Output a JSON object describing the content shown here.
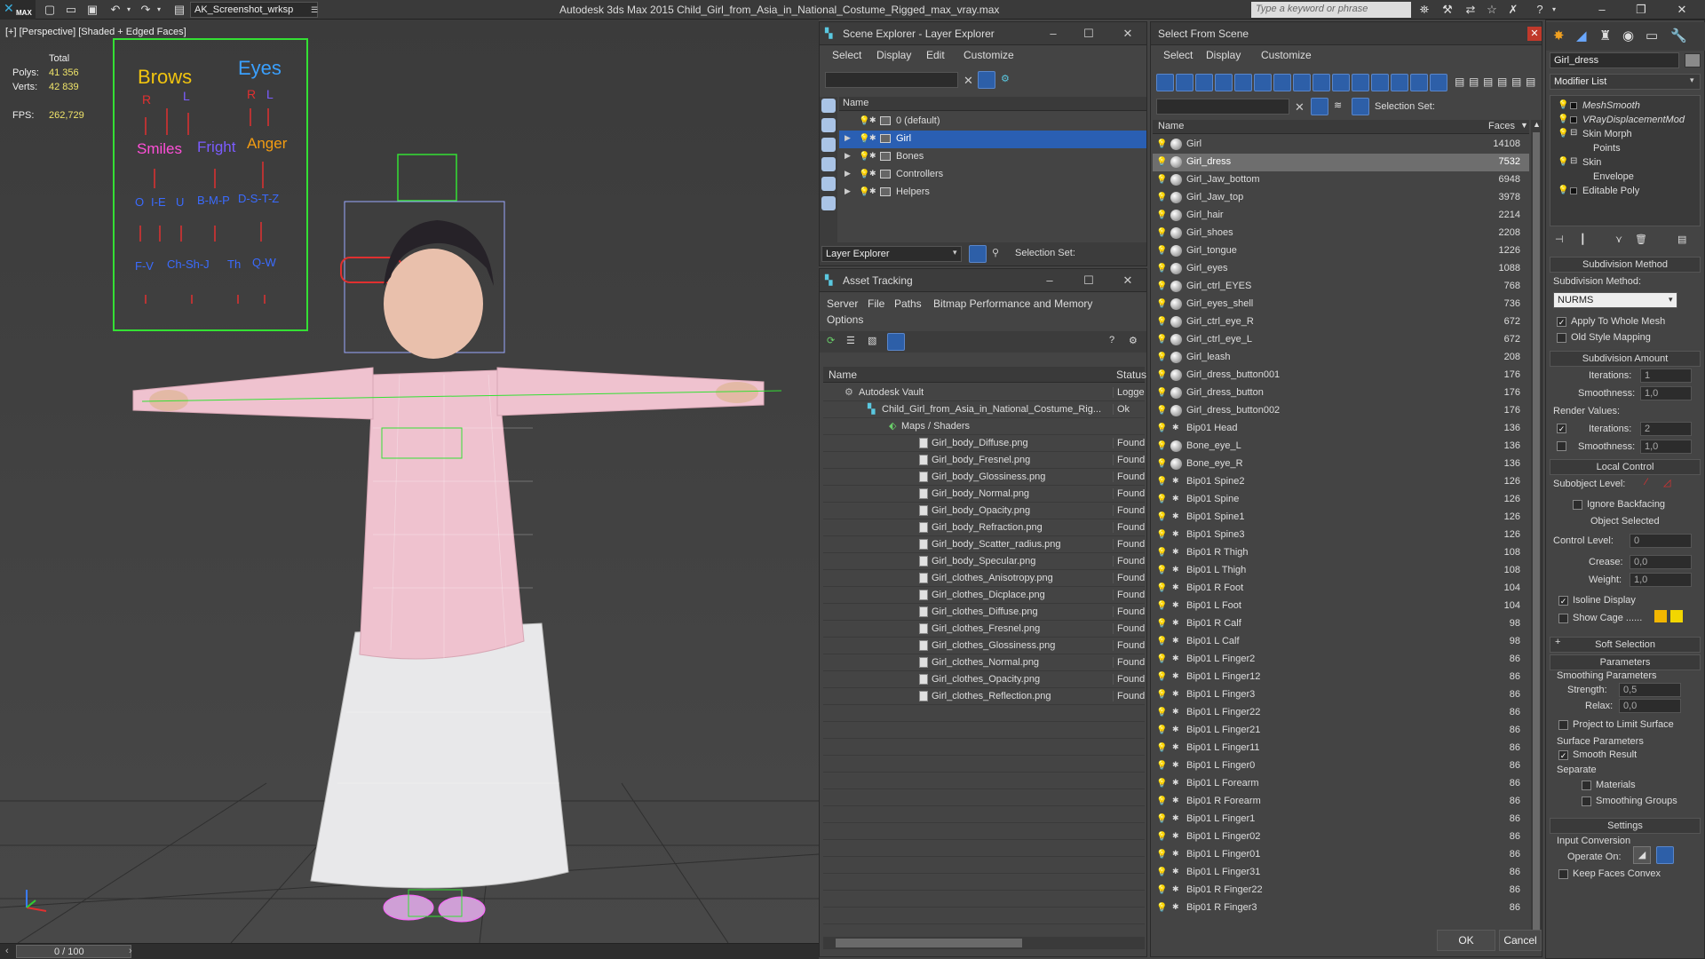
{
  "app": {
    "title": "Autodesk 3ds Max  2015     Child_Girl_from_Asia_in_National_Costume_Rigged_max_vray.max",
    "workspace": "AK_Screenshot_wrksp",
    "keyword_search_placeholder": "Type a keyword or phrase",
    "logo": "MAX"
  },
  "viewport": {
    "label": "[+] [Perspective] [Shaded + Edged Faces]",
    "stats": {
      "total_label": "Total",
      "polys_label": "Polys:",
      "polys_value": "41 356",
      "verts_label": "Verts:",
      "verts_value": "42 839",
      "fps_label": "FPS:",
      "fps_value": "262,729"
    },
    "control_board": {
      "brows": "Brows",
      "eyes": "Eyes",
      "r1": "R",
      "l1": "L",
      "r2": "R",
      "l2": "L",
      "smiles": "Smiles",
      "fright": "Fright",
      "anger": "Anger",
      "o": "O",
      "ie": "I-E",
      "u": "U",
      "bmp": "B-M-P",
      "dstz": "D-S-T-Z",
      "fv": "F-V",
      "chshj": "Ch-Sh-J",
      "th": "Th",
      "qw": "Q-W"
    },
    "timeline": "0 / 100"
  },
  "scene_explorer": {
    "title": "Scene Explorer - Layer Explorer",
    "menus": [
      "Select",
      "Display",
      "Edit",
      "Customize"
    ],
    "col_name": "Name",
    "layers": [
      {
        "name": "0 (default)",
        "selected": false,
        "expandable": false
      },
      {
        "name": "Girl",
        "selected": true,
        "expandable": true
      },
      {
        "name": "Bones",
        "selected": false,
        "expandable": true
      },
      {
        "name": "Controllers",
        "selected": false,
        "expandable": true
      },
      {
        "name": "Helpers",
        "selected": false,
        "expandable": true
      }
    ],
    "bottom_dropdown": "Layer Explorer",
    "selection_set_label": "Selection Set:"
  },
  "asset_tracking": {
    "title": "Asset Tracking",
    "menus": [
      "Server",
      "File",
      "Paths",
      "Bitmap Performance and Memory",
      "Options"
    ],
    "col_name": "Name",
    "col_status": "Status",
    "rows": [
      {
        "name": "Autodesk Vault",
        "status": "Logged",
        "indent": 0,
        "icon": "vault"
      },
      {
        "name": "Child_Girl_from_Asia_in_National_Costume_Rig...",
        "status": "Ok",
        "indent": 1,
        "icon": "max-file"
      },
      {
        "name": "Maps / Shaders",
        "status": "",
        "indent": 2,
        "icon": "maps"
      },
      {
        "name": "Girl_body_Diffuse.png",
        "status": "Found",
        "indent": 3,
        "icon": "png"
      },
      {
        "name": "Girl_body_Fresnel.png",
        "status": "Found",
        "indent": 3,
        "icon": "png"
      },
      {
        "name": "Girl_body_Glossiness.png",
        "status": "Found",
        "indent": 3,
        "icon": "png"
      },
      {
        "name": "Girl_body_Normal.png",
        "status": "Found",
        "indent": 3,
        "icon": "png"
      },
      {
        "name": "Girl_body_Opacity.png",
        "status": "Found",
        "indent": 3,
        "icon": "png"
      },
      {
        "name": "Girl_body_Refraction.png",
        "status": "Found",
        "indent": 3,
        "icon": "png"
      },
      {
        "name": "Girl_body_Scatter_radius.png",
        "status": "Found",
        "indent": 3,
        "icon": "png"
      },
      {
        "name": "Girl_body_Specular.png",
        "status": "Found",
        "indent": 3,
        "icon": "png"
      },
      {
        "name": "Girl_clothes_Anisotropy.png",
        "status": "Found",
        "indent": 3,
        "icon": "png"
      },
      {
        "name": "Girl_clothes_Dicplace.png",
        "status": "Found",
        "indent": 3,
        "icon": "png"
      },
      {
        "name": "Girl_clothes_Diffuse.png",
        "status": "Found",
        "indent": 3,
        "icon": "png"
      },
      {
        "name": "Girl_clothes_Fresnel.png",
        "status": "Found",
        "indent": 3,
        "icon": "png"
      },
      {
        "name": "Girl_clothes_Glossiness.png",
        "status": "Found",
        "indent": 3,
        "icon": "png"
      },
      {
        "name": "Girl_clothes_Normal.png",
        "status": "Found",
        "indent": 3,
        "icon": "png"
      },
      {
        "name": "Girl_clothes_Opacity.png",
        "status": "Found",
        "indent": 3,
        "icon": "png"
      },
      {
        "name": "Girl_clothes_Reflection.png",
        "status": "Found",
        "indent": 3,
        "icon": "png"
      }
    ]
  },
  "select_from_scene": {
    "title": "Select From Scene",
    "menus": [
      "Select",
      "Display",
      "Customize"
    ],
    "selection_set_label": "Selection Set:",
    "col_name": "Name",
    "col_faces": "Faces",
    "objects": [
      {
        "name": "Girl",
        "faces": "14108",
        "kind": "mesh"
      },
      {
        "name": "Girl_dress",
        "faces": "7532",
        "kind": "mesh",
        "highlighted": true
      },
      {
        "name": "Girl_Jaw_bottom",
        "faces": "6948",
        "kind": "mesh"
      },
      {
        "name": "Girl_Jaw_top",
        "faces": "3978",
        "kind": "mesh"
      },
      {
        "name": "Girl_hair",
        "faces": "2214",
        "kind": "mesh"
      },
      {
        "name": "Girl_shoes",
        "faces": "2208",
        "kind": "mesh"
      },
      {
        "name": "Girl_tongue",
        "faces": "1226",
        "kind": "mesh"
      },
      {
        "name": "Girl_eyes",
        "faces": "1088",
        "kind": "mesh"
      },
      {
        "name": "Girl_ctrl_EYES",
        "faces": "768",
        "kind": "mesh"
      },
      {
        "name": "Girl_eyes_shell",
        "faces": "736",
        "kind": "mesh"
      },
      {
        "name": "Girl_ctrl_eye_R",
        "faces": "672",
        "kind": "mesh"
      },
      {
        "name": "Girl_ctrl_eye_L",
        "faces": "672",
        "kind": "mesh"
      },
      {
        "name": "Girl_leash",
        "faces": "208",
        "kind": "mesh"
      },
      {
        "name": "Girl_dress_button001",
        "faces": "176",
        "kind": "mesh"
      },
      {
        "name": "Girl_dress_button",
        "faces": "176",
        "kind": "mesh"
      },
      {
        "name": "Girl_dress_button002",
        "faces": "176",
        "kind": "mesh"
      },
      {
        "name": "Bip01 Head",
        "faces": "136",
        "kind": "bone"
      },
      {
        "name": "Bone_eye_L",
        "faces": "136",
        "kind": "mesh"
      },
      {
        "name": "Bone_eye_R",
        "faces": "136",
        "kind": "mesh"
      },
      {
        "name": "Bip01 Spine2",
        "faces": "126",
        "kind": "bone"
      },
      {
        "name": "Bip01 Spine",
        "faces": "126",
        "kind": "bone"
      },
      {
        "name": "Bip01 Spine1",
        "faces": "126",
        "kind": "bone"
      },
      {
        "name": "Bip01 Spine3",
        "faces": "126",
        "kind": "bone"
      },
      {
        "name": "Bip01 R Thigh",
        "faces": "108",
        "kind": "bone"
      },
      {
        "name": "Bip01 L Thigh",
        "faces": "108",
        "kind": "bone"
      },
      {
        "name": "Bip01 R Foot",
        "faces": "104",
        "kind": "bone"
      },
      {
        "name": "Bip01 L Foot",
        "faces": "104",
        "kind": "bone"
      },
      {
        "name": "Bip01 R Calf",
        "faces": "98",
        "kind": "bone"
      },
      {
        "name": "Bip01 L Calf",
        "faces": "98",
        "kind": "bone"
      },
      {
        "name": "Bip01 L Finger2",
        "faces": "86",
        "kind": "bone"
      },
      {
        "name": "Bip01 L Finger12",
        "faces": "86",
        "kind": "bone"
      },
      {
        "name": "Bip01 L Finger3",
        "faces": "86",
        "kind": "bone"
      },
      {
        "name": "Bip01 L Finger22",
        "faces": "86",
        "kind": "bone"
      },
      {
        "name": "Bip01 L Finger21",
        "faces": "86",
        "kind": "bone"
      },
      {
        "name": "Bip01 L Finger11",
        "faces": "86",
        "kind": "bone"
      },
      {
        "name": "Bip01 L Finger0",
        "faces": "86",
        "kind": "bone"
      },
      {
        "name": "Bip01 L Forearm",
        "faces": "86",
        "kind": "bone"
      },
      {
        "name": "Bip01 R Forearm",
        "faces": "86",
        "kind": "bone"
      },
      {
        "name": "Bip01 L Finger1",
        "faces": "86",
        "kind": "bone"
      },
      {
        "name": "Bip01 L Finger02",
        "faces": "86",
        "kind": "bone"
      },
      {
        "name": "Bip01 L Finger01",
        "faces": "86",
        "kind": "bone"
      },
      {
        "name": "Bip01 L Finger31",
        "faces": "86",
        "kind": "bone"
      },
      {
        "name": "Bip01 R Finger22",
        "faces": "86",
        "kind": "bone"
      },
      {
        "name": "Bip01 R Finger3",
        "faces": "86",
        "kind": "bone"
      }
    ],
    "ok_label": "OK",
    "cancel_label": "Cancel"
  },
  "command_panel": {
    "object_name": "Girl_dress",
    "modifier_list_label": "Modifier List",
    "stack": [
      {
        "name": "MeshSmooth",
        "italic": true,
        "indent": 0
      },
      {
        "name": "VRayDisplacementMod",
        "italic": true,
        "indent": 0
      },
      {
        "name": "Skin Morph",
        "italic": false,
        "indent": 0
      },
      {
        "name": "Points",
        "italic": false,
        "indent": 1
      },
      {
        "name": "Skin",
        "italic": false,
        "indent": 0
      },
      {
        "name": "Envelope",
        "italic": false,
        "indent": 1
      },
      {
        "name": "Editable Poly",
        "italic": false,
        "indent": 0
      }
    ],
    "subdivision_method_header": "Subdivision Method",
    "subdivision_method_label": "Subdivision Method:",
    "subdivision_method_value": "NURMS",
    "apply_whole_mesh": "Apply To Whole Mesh",
    "old_style_mapping": "Old Style Mapping",
    "subdivision_amount_header": "Subdivision Amount",
    "iterations_label": "Iterations:",
    "iterations_value": "1",
    "smoothness_label": "Smoothness:",
    "smoothness_value": "1,0",
    "render_values_label": "Render Values:",
    "render_iterations_value": "2",
    "render_smoothness_value": "1,0",
    "local_control_header": "Local Control",
    "subobject_level_label": "Subobject Level:",
    "ignore_backfacing": "Ignore Backfacing",
    "object_selected": "Object Selected",
    "control_level_label": "Control Level:",
    "control_level_value": "0",
    "crease_label": "Crease:",
    "crease_value": "0,0",
    "weight_label": "Weight:",
    "weight_value": "1,0",
    "isoline_display": "Isoline Display",
    "show_cage": "Show Cage ......",
    "soft_selection_header": "Soft Selection",
    "parameters_header": "Parameters",
    "smoothing_parameters": "Smoothing Parameters",
    "strength_label": "Strength:",
    "strength_value": "0,5",
    "relax_label": "Relax:",
    "relax_value": "0,0",
    "project_limit_surface": "Project to Limit Surface",
    "surface_parameters": "Surface Parameters",
    "smooth_result": "Smooth Result",
    "separate_label": "Separate",
    "materials_label": "Materials",
    "smoothing_groups_label": "Smoothing Groups",
    "settings_header": "Settings",
    "input_conversion": "Input Conversion",
    "operate_on_label": "Operate On:",
    "keep_faces_convex": "Keep Faces Convex"
  }
}
